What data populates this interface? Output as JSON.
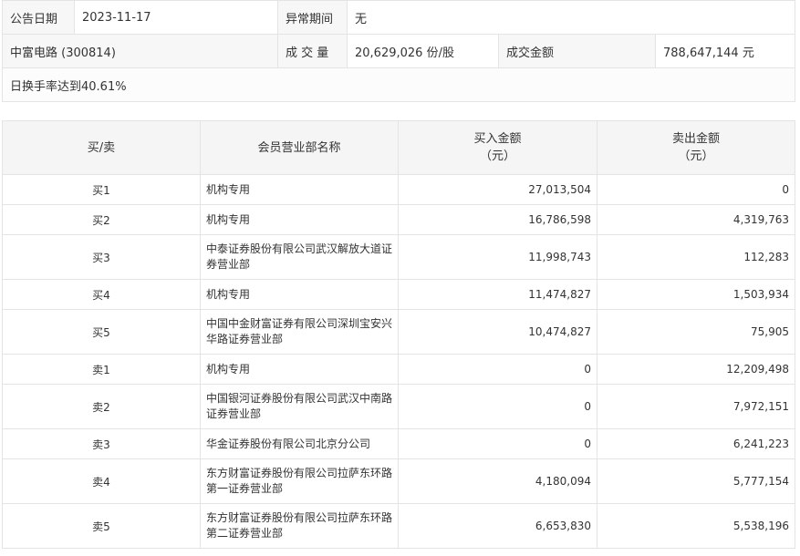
{
  "info": {
    "date_label": "公告日期",
    "date_value": "2023-11-17",
    "period_label": "异常期间",
    "period_value": "无",
    "stock_name": "中富电路 (300814)",
    "volume_label": "成 交 量",
    "volume_value": "20,629,026 份/股",
    "amount_label": "成交金额",
    "amount_value": "788,647,144 元",
    "note": "日换手率达到40.61%"
  },
  "table": {
    "headers": {
      "side": "买/卖",
      "name": "会员营业部名称",
      "buy": "买入金额",
      "buy_unit": "（元）",
      "sell": "卖出金额",
      "sell_unit": "（元）"
    },
    "rows": [
      {
        "side": "买1",
        "name": "机构专用",
        "buy": "27,013,504",
        "sell": "0"
      },
      {
        "side": "买2",
        "name": "机构专用",
        "buy": "16,786,598",
        "sell": "4,319,763"
      },
      {
        "side": "买3",
        "name": "中泰证券股份有限公司武汉解放大道证券营业部",
        "buy": "11,998,743",
        "sell": "112,283"
      },
      {
        "side": "买4",
        "name": "机构专用",
        "buy": "11,474,827",
        "sell": "1,503,934"
      },
      {
        "side": "买5",
        "name": "中国中金财富证券有限公司深圳宝安兴华路证券营业部",
        "buy": "10,474,827",
        "sell": "75,905"
      },
      {
        "side": "卖1",
        "name": "机构专用",
        "buy": "0",
        "sell": "12,209,498"
      },
      {
        "side": "卖2",
        "name": "中国银河证券股份有限公司武汉中南路证券营业部",
        "buy": "0",
        "sell": "7,972,151"
      },
      {
        "side": "卖3",
        "name": "华金证券股份有限公司北京分公司",
        "buy": "0",
        "sell": "6,241,223"
      },
      {
        "side": "卖4",
        "name": "东方财富证券股份有限公司拉萨东环路第一证券营业部",
        "buy": "4,180,094",
        "sell": "5,777,154"
      },
      {
        "side": "卖5",
        "name": "东方财富证券股份有限公司拉萨东环路第二证券营业部",
        "buy": "6,653,830",
        "sell": "5,538,196"
      }
    ]
  }
}
